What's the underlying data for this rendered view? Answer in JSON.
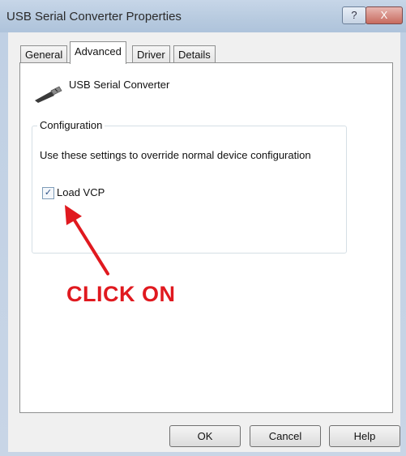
{
  "window": {
    "title": "USB Serial Converter Properties",
    "help_glyph": "?",
    "close_glyph": "X"
  },
  "tabs": [
    {
      "label": "General",
      "active": false
    },
    {
      "label": "Advanced",
      "active": true
    },
    {
      "label": "Driver",
      "active": false
    },
    {
      "label": "Details",
      "active": false
    }
  ],
  "device": {
    "icon": "usb-plug-icon",
    "name": "USB Serial Converter"
  },
  "configuration": {
    "legend": "Configuration",
    "description": "Use these settings to override normal device configuration",
    "load_vcp": {
      "label": "Load VCP",
      "checked": true,
      "check_glyph": "✓"
    }
  },
  "annotation": {
    "text": "CLICK ON",
    "color": "#e0191f"
  },
  "buttons": {
    "ok": "OK",
    "cancel": "Cancel",
    "help": "Help"
  }
}
